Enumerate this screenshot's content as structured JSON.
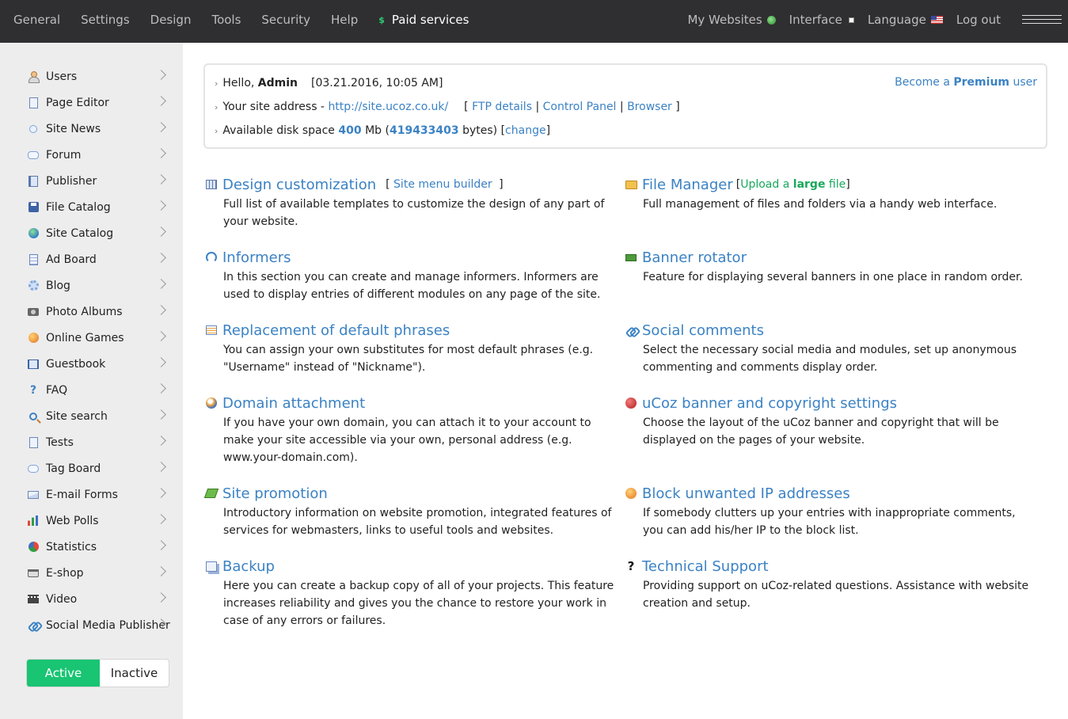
{
  "topbar": {
    "left_items": [
      "General",
      "Settings",
      "Design",
      "Tools",
      "Security",
      "Help"
    ],
    "paid_icon": "$",
    "paid_label": "Paid services",
    "my_websites": "My Websites",
    "interface": "Interface",
    "language": "Language",
    "logout": "Log out"
  },
  "sidebar": {
    "items": [
      {
        "label": "Users",
        "icon": "user-icon"
      },
      {
        "label": "Page Editor",
        "icon": "page-icon"
      },
      {
        "label": "Site News",
        "icon": "bulb-icon"
      },
      {
        "label": "Forum",
        "icon": "chat-icon"
      },
      {
        "label": "Publisher",
        "icon": "book-icon"
      },
      {
        "label": "File Catalog",
        "icon": "disk-icon"
      },
      {
        "label": "Site Catalog",
        "icon": "globe-icon"
      },
      {
        "label": "Ad Board",
        "icon": "board-icon"
      },
      {
        "label": "Blog",
        "icon": "gear-icon"
      },
      {
        "label": "Photo Albums",
        "icon": "camera-icon"
      },
      {
        "label": "Online Games",
        "icon": "game-icon"
      },
      {
        "label": "Guestbook",
        "icon": "guestbook-icon"
      },
      {
        "label": "FAQ",
        "icon": "faq-icon"
      },
      {
        "label": "Site search",
        "icon": "search-icon"
      },
      {
        "label": "Tests",
        "icon": "page-icon"
      },
      {
        "label": "Tag Board",
        "icon": "tag-icon"
      },
      {
        "label": "E-mail Forms",
        "icon": "mail-icon"
      },
      {
        "label": "Web Polls",
        "icon": "polls-icon"
      },
      {
        "label": "Statistics",
        "icon": "stats-icon"
      },
      {
        "label": "E-shop",
        "icon": "cart-icon"
      },
      {
        "label": "Video",
        "icon": "video-icon"
      },
      {
        "label": "Social Media Publisher",
        "icon": "link-icon"
      }
    ],
    "toggle_active": "Active",
    "toggle_inactive": "Inactive"
  },
  "info": {
    "hello": "Hello,",
    "user": "Admin",
    "datetime": "[03.21.2016, 10:05 AM]",
    "site_address_label": "Your site address -",
    "site_url": "http://site.ucoz.co.uk/",
    "bracket_open": "[",
    "ftp": "FTP details",
    "sep": "|",
    "control_panel": "Control Panel",
    "browser": "Browser",
    "bracket_close": "]",
    "disk_label": "Available disk space",
    "disk_mb": "400",
    "disk_unit": "Mb (",
    "disk_bytes": "419433403",
    "disk_bytes_suffix": "bytes) [",
    "change": "change",
    "close_bracket": "]",
    "become": "Become a",
    "premium": "Premium",
    "user_word": "user"
  },
  "features": {
    "design": {
      "title": "Design customization",
      "extra_open": "[",
      "extra_link": "Site menu builder",
      "extra_close": "]",
      "desc": "Full list of available templates to customize the design of any part of your website."
    },
    "file_manager": {
      "title": "File Manager",
      "extra_open": "[",
      "upload_a": "Upload a",
      "upload_large": "large",
      "upload_file": "file",
      "extra_close": "]",
      "desc": "Full management of files and folders via a handy web interface."
    },
    "informers": {
      "title": "Informers",
      "desc": "In this section you can create and manage informers. Informers are used to display entries of different modules on any page of the site."
    },
    "banner": {
      "title": "Banner rotator",
      "desc": "Feature for displaying several banners in one place in random order."
    },
    "phrases": {
      "title": "Replacement of default phrases",
      "desc": "You can assign your own substitutes for most default phrases (e.g. \"Username\" instead of \"Nickname\")."
    },
    "social": {
      "title": "Social comments",
      "desc": "Select the necessary social media and modules, set up anonymous commenting and comments display order."
    },
    "domain": {
      "title": "Domain attachment",
      "desc": "If you have your own domain, you can attach it to your account to make your site accessible via your own, personal address (e.g. www.your-domain.com)."
    },
    "copyright": {
      "title": "uCoz banner and copyright settings",
      "desc": "Choose the layout of the uCoz banner and copyright that will be displayed on the pages of your website."
    },
    "promotion": {
      "title": "Site promotion",
      "desc": "Introductory information on website promotion, integrated features of services for webmasters, links to useful tools and websites."
    },
    "block_ip": {
      "title": "Block unwanted IP addresses",
      "desc": "If somebody clutters up your entries with inappropriate comments, you can add his/her IP to the block list."
    },
    "backup": {
      "title": "Backup",
      "desc": "Here you can create a backup copy of all of your projects. This feature increases reliability and gives you the chance to restore your work in case of any errors or failures."
    },
    "support": {
      "icon_glyph": "?",
      "title": "Technical Support",
      "desc": "Providing support on uCoz-related questions. Assistance with website creation and setup."
    }
  },
  "colors": {
    "accent": "#3b82c4",
    "active_green": "#19c473",
    "topbar_bg": "#2f2f31",
    "sidebar_bg": "#ededed"
  }
}
